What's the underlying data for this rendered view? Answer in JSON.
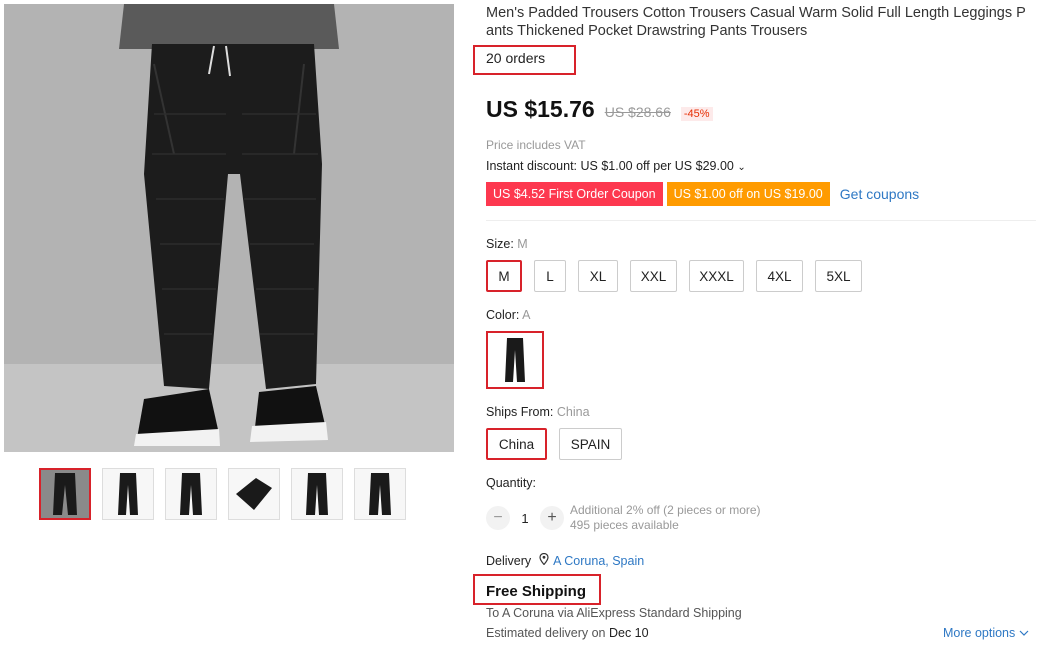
{
  "product": {
    "title": "Men's Padded Trousers Cotton Trousers Casual Warm Solid Full Length Leggings Pants Thickened Pocket Drawstring Pants Trousers",
    "orders": "20 orders"
  },
  "pricing": {
    "price": "US $15.76",
    "original_price": "US $28.66",
    "discount": "-45%",
    "vat_note": "Price includes VAT",
    "instant_discount": "Instant discount: US $1.00 off per US $29.00",
    "coupons": [
      "US $4.52 First Order Coupon",
      "US $1.00 off on US $19.00"
    ],
    "get_coupons": "Get coupons"
  },
  "size": {
    "label": "Size: ",
    "selected": "M",
    "options": [
      "M",
      "L",
      "XL",
      "XXL",
      "XXXL",
      "4XL",
      "5XL"
    ]
  },
  "color": {
    "label": "Color: ",
    "selected": "A"
  },
  "ships_from": {
    "label": "Ships From: ",
    "selected": "China",
    "options": [
      "China",
      "SPAIN"
    ]
  },
  "quantity": {
    "label": "Quantity:",
    "minus": "−",
    "value": "1",
    "plus": "+",
    "note_line1": "Additional 2% off (2 pieces or more)",
    "note_line2": "495 pieces available"
  },
  "delivery": {
    "label": "Delivery",
    "location": "A Coruna, Spain",
    "free_shipping": "Free Shipping",
    "via": "To A Coruna via AliExpress Standard Shipping",
    "eta_prefix": "Estimated delivery on ",
    "eta_date": "Dec 10",
    "more_options": "More options"
  },
  "colors": {
    "accent_red": "#d8222a",
    "coupon_red": "#fd384f",
    "coupon_orange": "#ff9b00",
    "link_blue": "#2e78c4"
  }
}
